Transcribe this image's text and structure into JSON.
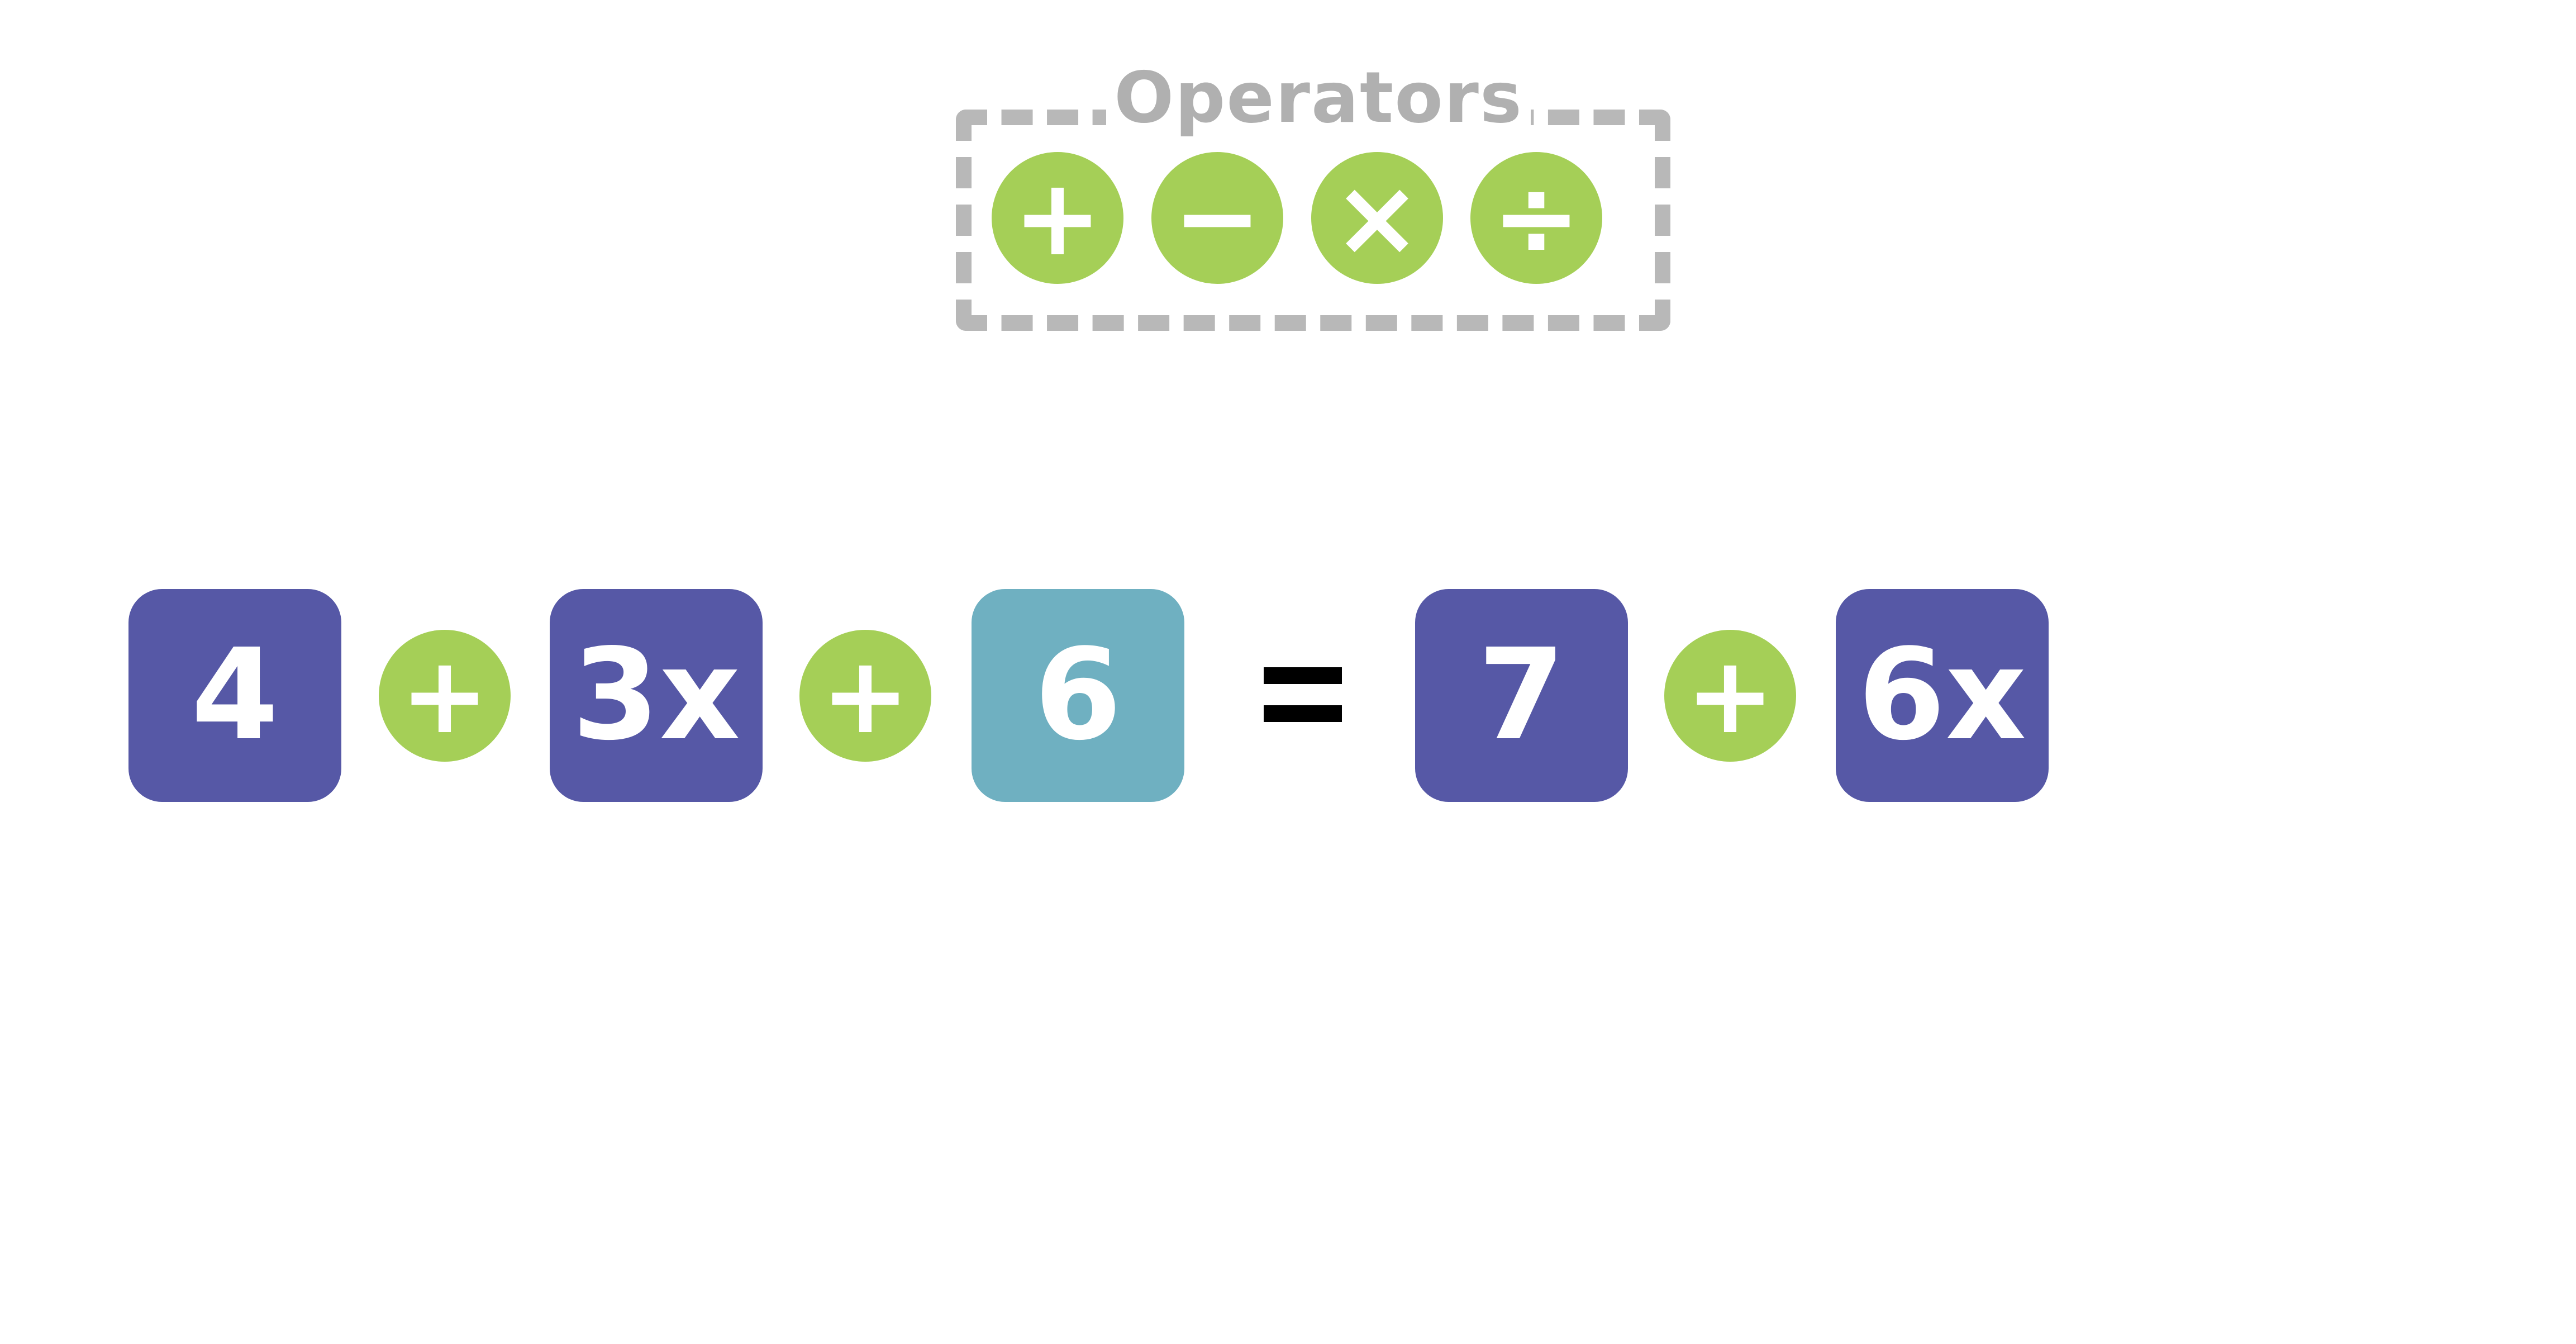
{
  "palette": {
    "title": "Operators",
    "operators": [
      {
        "symbol": "+",
        "name": "plus"
      },
      {
        "symbol": "−",
        "name": "minus"
      },
      {
        "symbol": "×",
        "name": "times"
      },
      {
        "symbol": "÷",
        "name": "divide"
      }
    ]
  },
  "equation": {
    "left": [
      {
        "type": "term",
        "text": "4",
        "kind": "variable-color"
      },
      {
        "type": "operator",
        "text": "+"
      },
      {
        "type": "term",
        "text": "3x",
        "kind": "variable-color"
      },
      {
        "type": "operator",
        "text": "+"
      },
      {
        "type": "term",
        "text": "6",
        "kind": "constant-color"
      }
    ],
    "equals": "=",
    "right": [
      {
        "type": "term",
        "text": "7",
        "kind": "variable-color"
      },
      {
        "type": "operator",
        "text": "+"
      },
      {
        "type": "term",
        "text": "6x",
        "kind": "variable-color"
      }
    ]
  },
  "colors": {
    "term_tile": "#5658a6",
    "highlight_tile": "#6fb0c1",
    "operator": "#a5cf57",
    "palette_border": "#b8b8b8",
    "palette_title": "#b0b0b0"
  },
  "icons": {
    "plus": "plus-icon",
    "minus": "minus-icon",
    "times": "multiply-icon",
    "divide": "divide-icon",
    "equals": "equals-icon"
  }
}
